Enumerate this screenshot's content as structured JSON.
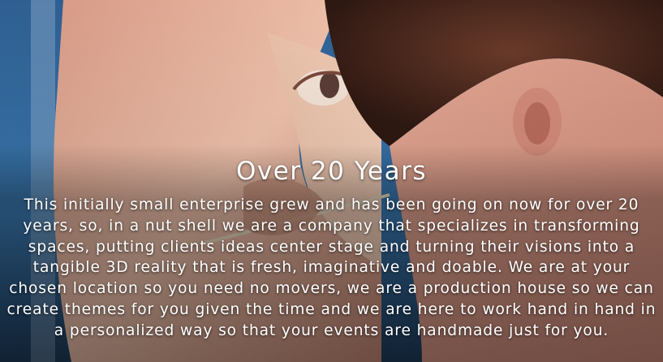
{
  "section": {
    "title": "Over 20 Years",
    "description": "This initially small enterprise grew and has been going on now for over 20 years, so, in a nut shell we are a company that specializes in transforming spaces, putting clients ideas center stage and turning their visions into a tangible 3D reality that is fresh, imaginative and doable. We are at your chosen location so you need no movers, we are a production house so we can create themes for you given the time and we are here to work hand in hand in a personalized way so that your events are handmade just for you."
  },
  "colors": {
    "text": "#ffffff",
    "sky_blue": "#3a6fa0",
    "skin_tone": "#e8b49a",
    "hair": "#4a2a1e"
  }
}
